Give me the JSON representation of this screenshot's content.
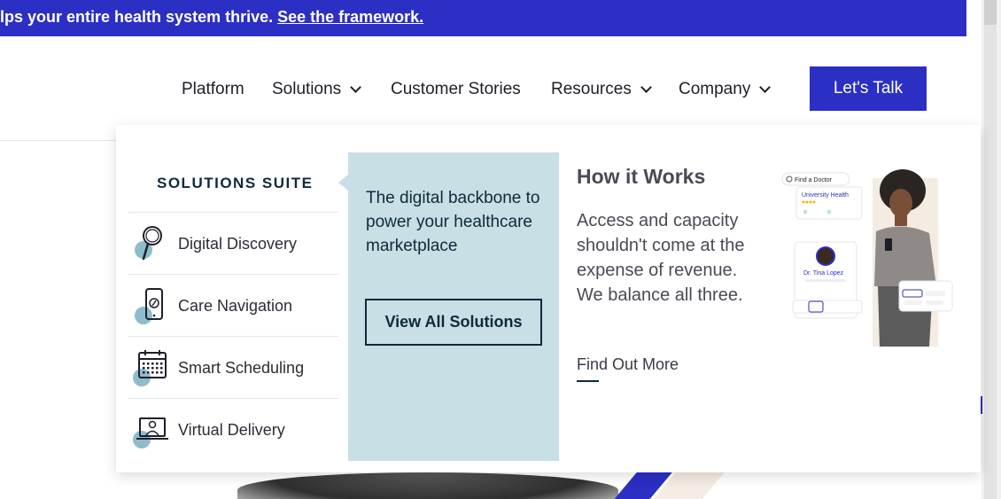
{
  "announcement": {
    "text": "lps your entire health system thrive.",
    "link": "See the framework."
  },
  "nav": {
    "items": [
      {
        "label": "Platform",
        "has_dropdown": false
      },
      {
        "label": "Solutions",
        "has_dropdown": true
      },
      {
        "label": "Customer Stories",
        "has_dropdown": false
      },
      {
        "label": "Resources",
        "has_dropdown": true
      },
      {
        "label": "Company",
        "has_dropdown": true
      }
    ],
    "cta": "Let's Talk"
  },
  "dropdown": {
    "suite_title": "SOLUTIONS SUITE",
    "items": [
      {
        "label": "Digital Discovery",
        "icon": "magnifier-icon"
      },
      {
        "label": "Care Navigation",
        "icon": "phone-compass-icon"
      },
      {
        "label": "Smart Scheduling",
        "icon": "calendar-icon"
      },
      {
        "label": "Virtual Delivery",
        "icon": "laptop-doctor-icon"
      }
    ],
    "panel": {
      "text": "The digital backbone to power your healthcare marketplace",
      "button": "View All Solutions"
    },
    "how": {
      "title": "How it Works",
      "body": "Access and capacity shouldn't come at the expense of revenue. We balance all three.",
      "link": "Find Out More"
    },
    "visual": {
      "search_label": "Find a Doctor",
      "org": "University Health",
      "doctor": "Dr. Tina Lopez"
    }
  },
  "colors": {
    "brand_blue": "#2b2fc4",
    "panel_blue": "#c7dfe5",
    "dark_navy": "#0e2a3b",
    "icon_dot": "#8fbccb"
  }
}
